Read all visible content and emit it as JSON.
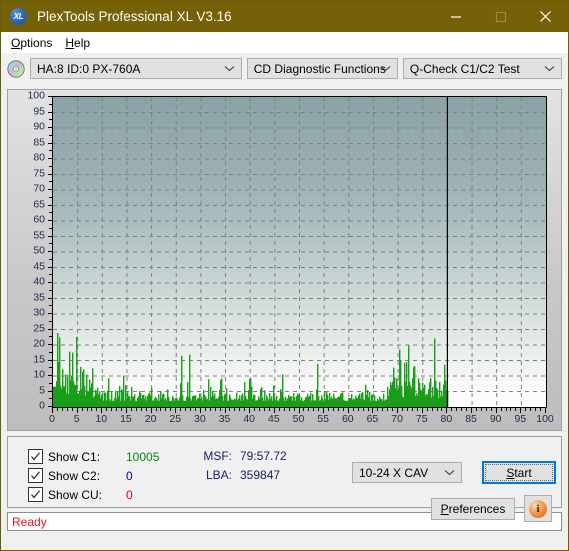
{
  "window": {
    "title": "PlexTools Professional XL V3.16",
    "app_icon": "xl-disc-icon",
    "minimize_label": "—",
    "maximize_label": "□",
    "close_label": "✕",
    "titlebar_color": "#756107"
  },
  "menu": {
    "items": [
      {
        "label": "Options",
        "accel": "O"
      },
      {
        "label": "Help",
        "accel": "H"
      }
    ]
  },
  "toolbar": {
    "drive_select": {
      "value": "HA:8 ID:0  PX-760A"
    },
    "function_select": {
      "value": "CD Diagnostic Functions"
    },
    "test_select": {
      "value": "Q-Check C1/C2 Test"
    }
  },
  "controls": {
    "checkboxes": [
      {
        "label": "Show C1:",
        "checked": true,
        "value": "10005",
        "color": "#108010"
      },
      {
        "label": "Show C2:",
        "checked": true,
        "value": "0",
        "color": "#0000cc"
      },
      {
        "label": "Show CU:",
        "checked": true,
        "value": "0",
        "color": "#e00000"
      }
    ],
    "readouts": [
      {
        "label": "MSF:",
        "value": "79:57.72"
      },
      {
        "label": "LBA:",
        "value": "359847"
      }
    ],
    "speed_select": {
      "value": "10-24 X CAV"
    },
    "start_button": {
      "label": "Start",
      "accel": "S"
    },
    "preferences_button": {
      "label": "Preferences",
      "accel": "P"
    },
    "info_button": {
      "label": "i"
    }
  },
  "statusbar": {
    "text": "Ready",
    "color": "#e81123"
  },
  "chart_data": {
    "type": "area",
    "title": "",
    "xlabel": "",
    "ylabel": "",
    "xlim": [
      0,
      100
    ],
    "ylim": [
      0,
      100
    ],
    "xticks": [
      0,
      5,
      10,
      15,
      20,
      25,
      30,
      35,
      40,
      45,
      50,
      55,
      60,
      65,
      70,
      75,
      80,
      85,
      90,
      95,
      100
    ],
    "yticks": [
      0,
      5,
      10,
      15,
      20,
      25,
      30,
      35,
      40,
      45,
      50,
      55,
      60,
      65,
      70,
      75,
      80,
      85,
      90,
      95,
      100
    ],
    "grid": true,
    "legend": false,
    "series_color": "#1a9e1a",
    "marker_line_x": 80,
    "data_end_x": 80,
    "series": [
      {
        "name": "C1 errors",
        "color": "#1a9e1a",
        "x": [
          0.2,
          0.5,
          0.8,
          1.0,
          1.2,
          1.4,
          1.6,
          1.8,
          2.0,
          2.2,
          2.5,
          2.8,
          3.0,
          3.3,
          3.6,
          3.9,
          4.2,
          4.5,
          4.8,
          5.1,
          5.4,
          5.7,
          6.0,
          6.3,
          6.6,
          7.0,
          7.4,
          7.8,
          8.2,
          8.6,
          9.0,
          9.4,
          9.8,
          10.2,
          10.6,
          11.0,
          11.4,
          11.8,
          12.2,
          12.6,
          13.0,
          13.5,
          14.0,
          14.5,
          15.0,
          15.5,
          16.0,
          16.5,
          17.0,
          17.5,
          18.0,
          18.5,
          19.0,
          19.5,
          20.0,
          20.5,
          21.0,
          21.5,
          22.0,
          22.5,
          23.0,
          23.5,
          24.0,
          24.5,
          25.0,
          25.5,
          26.0,
          26.5,
          27.0,
          27.5,
          28.0,
          28.5,
          29.0,
          29.5,
          30.0,
          30.5,
          31.0,
          31.5,
          32.0,
          32.5,
          33.0,
          33.5,
          34.0,
          34.5,
          35.0,
          35.5,
          36.0,
          36.5,
          37.0,
          37.5,
          38.0,
          38.5,
          39.0,
          39.5,
          40.0,
          40.5,
          41.0,
          41.5,
          42.0,
          42.5,
          43.0,
          43.5,
          44.0,
          44.5,
          45.0,
          45.5,
          46.0,
          46.5,
          47.0,
          47.5,
          48.0,
          48.5,
          49.0,
          49.5,
          50.0,
          50.5,
          51.0,
          51.5,
          52.0,
          52.5,
          53.0,
          53.5,
          54.0,
          54.5,
          55.0,
          55.5,
          56.0,
          56.5,
          57.0,
          57.5,
          58.0,
          58.5,
          59.0,
          59.5,
          60.0,
          60.5,
          61.0,
          61.5,
          62.0,
          62.5,
          63.0,
          63.5,
          64.0,
          64.5,
          65.0,
          65.5,
          66.0,
          66.5,
          67.0,
          67.5,
          68.0,
          68.5,
          69.0,
          69.5,
          70.0,
          70.5,
          71.0,
          71.5,
          72.0,
          72.5,
          73.0,
          73.5,
          74.0,
          74.5,
          75.0,
          75.5,
          76.0,
          76.5,
          77.0,
          77.5,
          78.0,
          78.5,
          79.0,
          79.4,
          79.8
        ],
        "y": [
          10,
          14,
          16,
          22,
          18,
          15,
          13,
          16,
          12,
          14,
          15,
          13,
          11,
          14,
          12,
          13,
          11,
          10,
          12,
          10,
          9,
          11,
          8,
          9,
          13,
          8,
          7,
          9,
          6,
          8,
          7,
          6,
          8,
          5,
          6,
          7,
          5,
          6,
          4,
          5,
          6,
          4,
          10,
          5,
          6,
          4,
          5,
          7,
          4,
          5,
          6,
          4,
          5,
          16,
          5,
          4,
          6,
          4,
          5,
          7,
          4,
          5,
          4,
          6,
          4,
          5,
          12,
          4,
          5,
          6,
          4,
          5,
          4,
          6,
          4,
          5,
          4,
          7,
          4,
          5,
          6,
          4,
          13,
          5,
          4,
          6,
          5,
          4,
          7,
          5,
          4,
          6,
          4,
          5,
          15,
          5,
          4,
          6,
          4,
          5,
          4,
          6,
          5,
          4,
          7,
          4,
          5,
          6,
          4,
          5,
          4,
          6,
          4,
          5,
          7,
          4,
          5,
          4,
          6,
          5,
          4,
          8,
          4,
          5,
          4,
          6,
          5,
          4,
          7,
          4,
          5,
          6,
          4,
          5,
          4,
          6,
          5,
          4,
          7,
          5,
          4,
          6,
          4,
          5,
          4,
          3,
          4,
          3,
          4,
          3,
          12,
          10,
          11,
          13,
          10,
          12,
          9,
          11,
          14,
          10,
          12,
          9,
          11,
          10,
          12,
          9,
          11,
          8,
          10,
          12,
          9,
          11,
          8,
          10,
          9,
          11,
          8,
          10,
          7,
          9,
          12,
          10,
          8,
          10,
          12,
          9,
          11,
          8,
          10,
          7,
          9,
          8,
          10,
          7,
          9,
          6,
          8,
          7,
          9,
          6,
          8,
          7,
          9,
          6,
          8,
          7,
          9,
          6,
          8,
          7,
          9,
          6,
          8,
          7,
          9,
          6,
          8,
          7,
          9,
          6,
          8,
          7,
          9,
          6,
          8,
          7,
          9,
          6,
          8,
          7,
          9,
          6,
          8,
          7,
          9,
          6,
          8,
          7,
          9,
          6,
          8,
          7,
          9,
          6,
          8,
          7,
          9,
          6,
          8,
          7,
          9,
          6,
          8,
          7,
          9,
          6,
          8,
          7,
          9,
          6,
          8,
          7,
          9,
          6,
          8,
          7,
          9,
          6,
          8,
          7,
          9,
          6,
          8,
          7,
          9,
          6,
          8,
          7,
          9,
          6,
          8,
          7,
          9,
          6,
          8,
          7,
          9,
          6,
          8,
          7,
          9,
          6,
          8,
          7,
          9,
          6,
          8,
          7,
          9,
          6,
          8,
          7,
          9,
          6,
          8,
          7,
          9,
          6,
          8,
          7,
          9,
          6,
          8,
          7,
          9,
          6,
          8,
          7,
          9,
          6,
          8,
          7,
          9,
          6,
          8,
          7,
          9,
          6,
          8,
          7
        ]
      }
    ]
  }
}
